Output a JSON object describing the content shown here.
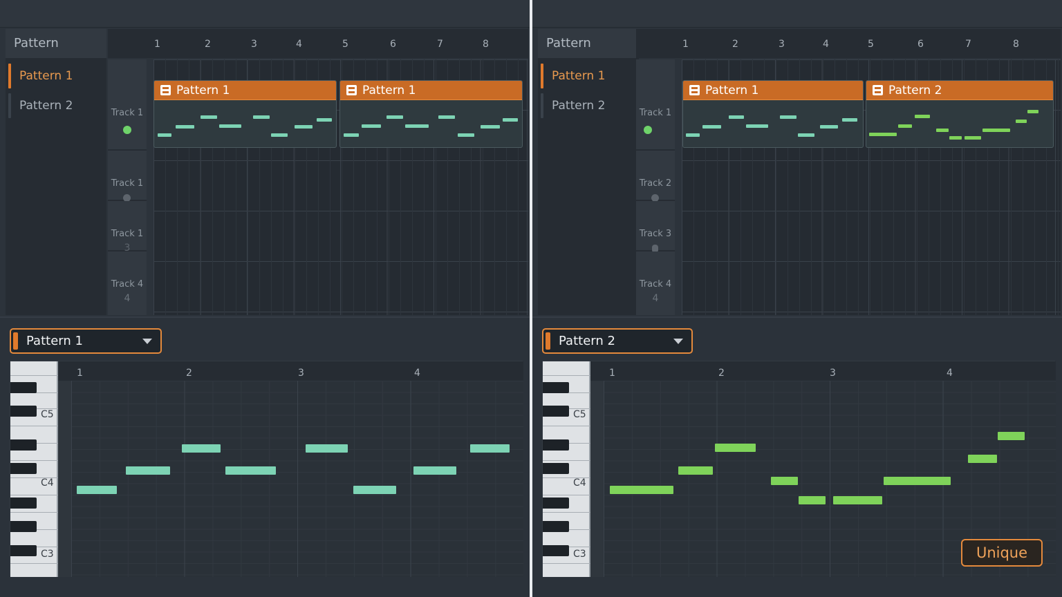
{
  "colors": {
    "accent": "#e07a2c",
    "clip_header": "#c96b25",
    "note_teal": "#7dd3b4",
    "note_green": "#7fd35a",
    "active_dot": "#6fd36a",
    "inactive_dot": "#5d646c"
  },
  "panels": [
    {
      "sidebar": {
        "title": "Pattern",
        "items": [
          {
            "label": "Pattern 1",
            "selected": true
          },
          {
            "label": "Pattern 2",
            "selected": false
          }
        ]
      },
      "ruler": [
        "1",
        "2",
        "3",
        "4",
        "5",
        "6",
        "7",
        "8"
      ],
      "tracks": [
        {
          "label": "Track 1",
          "indicator": "",
          "indicator_type": "dot-active"
        },
        {
          "label": "Track 1",
          "indicator": "",
          "indicator_type": "dot"
        },
        {
          "label": "Track 1",
          "indicator": "3",
          "indicator_type": "text"
        },
        {
          "label": "Track 4",
          "indicator": "4",
          "indicator_type": "text"
        }
      ],
      "clips": [
        {
          "title": "Pattern 1",
          "icon": "pattern-icon",
          "note_color": "teal"
        },
        {
          "title": "Pattern 1",
          "icon": "pattern-icon",
          "note_color": "teal"
        }
      ],
      "editor": {
        "selected_pattern": "Pattern 1",
        "bar_numbers": [
          "1",
          "2",
          "3",
          "4"
        ],
        "key_labels": [
          "C5",
          "C4",
          "C3"
        ],
        "note_color": "teal"
      }
    },
    {
      "sidebar": {
        "title": "Pattern",
        "items": [
          {
            "label": "Pattern 1",
            "selected": true
          },
          {
            "label": "Pattern 2",
            "selected": false
          }
        ]
      },
      "ruler": [
        "1",
        "2",
        "3",
        "4",
        "5",
        "6",
        "7",
        "8"
      ],
      "tracks": [
        {
          "label": "Track 1",
          "indicator": "",
          "indicator_type": "dot-active"
        },
        {
          "label": "Track 2",
          "indicator": "",
          "indicator_type": "dot"
        },
        {
          "label": "Track 3",
          "indicator": "",
          "indicator_type": "dot"
        },
        {
          "label": "Track 4",
          "indicator": "4",
          "indicator_type": "text"
        }
      ],
      "clips": [
        {
          "title": "Pattern 1",
          "icon": "pattern-icon",
          "note_color": "teal"
        },
        {
          "title": "Pattern 2",
          "icon": "pattern-icon",
          "note_color": "green"
        }
      ],
      "editor": {
        "selected_pattern": "Pattern 2",
        "bar_numbers": [
          "1",
          "2",
          "3",
          "4"
        ],
        "key_labels": [
          "C5",
          "C4",
          "C3"
        ],
        "note_color": "green",
        "unique_button": "Unique"
      }
    }
  ]
}
